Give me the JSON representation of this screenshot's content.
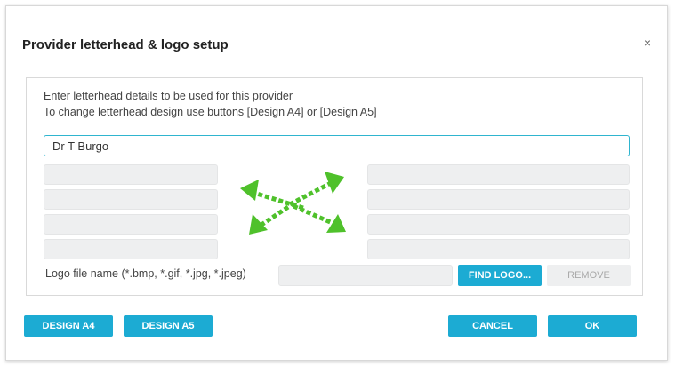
{
  "dialog": {
    "title": "Provider letterhead & logo setup",
    "close_glyph": "×"
  },
  "panel": {
    "instruction_line1": "Enter letterhead details to be used for this provider",
    "instruction_line2": "To change letterhead design use buttons [Design A4] or [Design A5]",
    "name_value": "Dr T Burgo",
    "left_fields": [
      "",
      "",
      "",
      ""
    ],
    "right_fields": [
      "",
      "",
      "",
      ""
    ],
    "arrows_icon": "crossed-arrows-icon",
    "arrows_color": "#4fc12b",
    "logo_label": "Logo file name (*.bmp, *.gif, *.jpg, *.jpeg)",
    "logo_value": "",
    "find_logo_label": "FIND LOGO...",
    "remove_label": "REMOVE"
  },
  "footer": {
    "design_a4_label": "DESIGN A4",
    "design_a5_label": "DESIGN A5",
    "cancel_label": "CANCEL",
    "ok_label": "OK"
  },
  "colors": {
    "accent": "#1cabd3",
    "input_focus_border": "#2fb5cf",
    "disabled_bg": "#eeeff0"
  }
}
